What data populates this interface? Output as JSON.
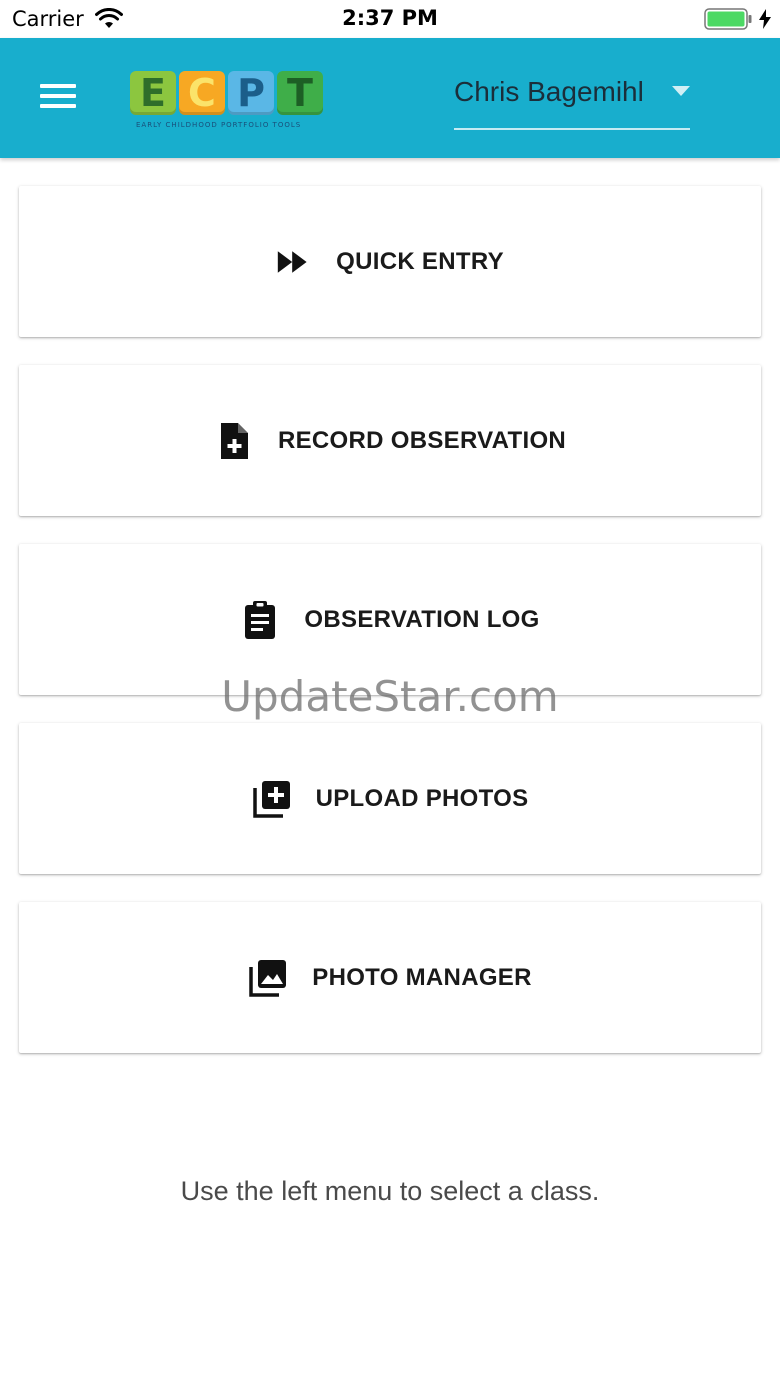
{
  "status_bar": {
    "carrier": "Carrier",
    "time": "2:37 PM",
    "wifi_icon": "wifi-icon",
    "battery_icon": "battery-icon"
  },
  "app_bar": {
    "background": "#18aecd",
    "menu_icon": "hamburger-menu-icon",
    "logo": {
      "letters": [
        "E",
        "C",
        "P",
        "T"
      ],
      "tagline": "EARLY CHILDHOOD PORTFOLIO TOOLS"
    },
    "user_select": {
      "value": "Chris Bagemihl",
      "caret_icon": "caret-down-icon"
    }
  },
  "actions": [
    {
      "label": "QUICK ENTRY",
      "icon": "fast-forward-icon"
    },
    {
      "label": "RECORD OBSERVATION",
      "icon": "file-plus-icon"
    },
    {
      "label": "OBSERVATION LOG",
      "icon": "clipboard-icon"
    },
    {
      "label": "UPLOAD PHOTOS",
      "icon": "add-to-library-icon"
    },
    {
      "label": "PHOTO MANAGER",
      "icon": "photo-library-icon"
    }
  ],
  "watermark": "UpdateStar.com",
  "hint": "Use the left menu to select a class."
}
